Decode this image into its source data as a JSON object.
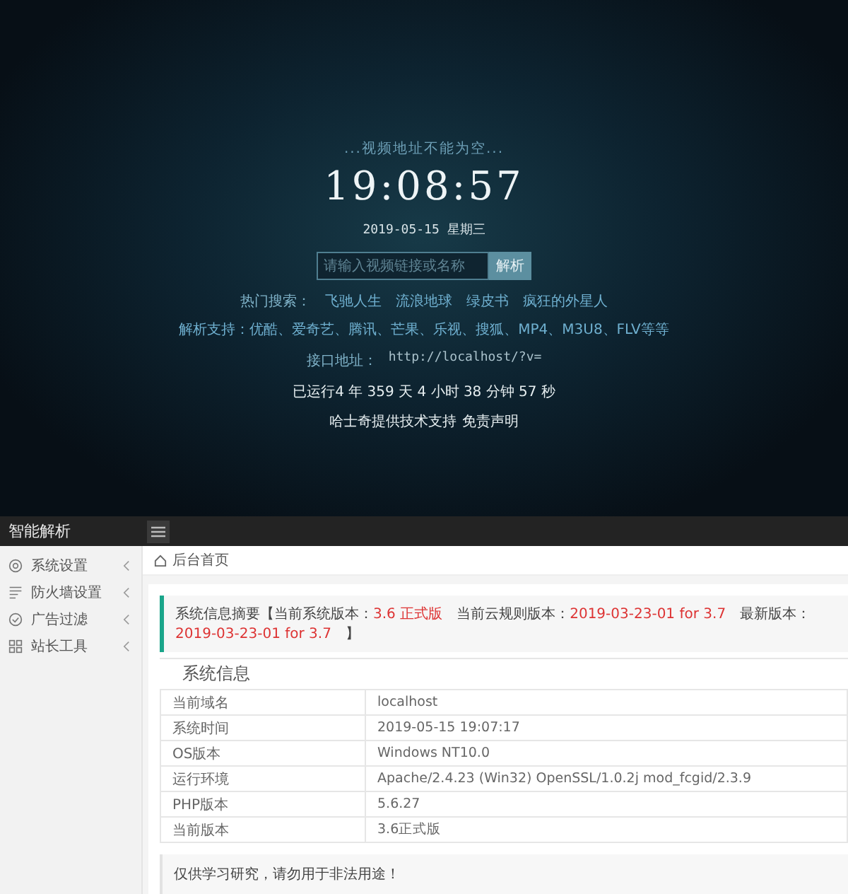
{
  "player": {
    "notice": "...视频地址不能为空...",
    "clock": "19:08:57",
    "date": "2019-05-15 星期三",
    "search": {
      "placeholder": "请输入视频链接或名称",
      "button": "解析"
    },
    "hot": {
      "label": "热门搜索：",
      "items": [
        "飞驰人生",
        "流浪地球",
        "绿皮书",
        "疯狂的外星人"
      ]
    },
    "support": "解析支持：优酷、爱奇艺、腾讯、芒果、乐视、搜狐、MP4、M3U8、FLV等等",
    "api": {
      "label": "接口地址：",
      "url": "http://localhost/?v="
    },
    "uptime": "已运行4 年 359 天 4 小时 38 分钟 57 秒",
    "footer": {
      "credit": "哈士奇提供技术支持",
      "link": "免责声明"
    }
  },
  "admin": {
    "title": "智能解析",
    "sidebar": {
      "items": [
        {
          "label": "系统设置"
        },
        {
          "label": "防火墙设置"
        },
        {
          "label": "广告过滤"
        },
        {
          "label": "站长工具"
        }
      ]
    },
    "breadcrumb": "后台首页",
    "summary": [
      {
        "text": "系统信息摘要【当前系统版本：",
        "highlight": false
      },
      {
        "text": "3.6 正式版",
        "highlight": true
      },
      {
        "text": "　当前云规则版本：",
        "highlight": false
      },
      {
        "text": "2019-03-23-01 for 3.7",
        "highlight": true
      },
      {
        "text": "　最新版本：",
        "highlight": false
      },
      {
        "text": "2019-03-23-01 for 3.7",
        "highlight": true
      },
      {
        "text": "　】",
        "highlight": false
      }
    ],
    "info": {
      "legend": "系统信息",
      "rows": [
        {
          "key": "当前域名",
          "value": "localhost"
        },
        {
          "key": "系统时间",
          "value": "2019-05-15 19:07:17"
        },
        {
          "key": "OS版本",
          "value": "Windows NT10.0"
        },
        {
          "key": "运行环境",
          "value": "Apache/2.4.23 (Win32) OpenSSL/1.0.2j mod_fcgid/2.3.9"
        },
        {
          "key": "PHP版本",
          "value": "5.6.27"
        },
        {
          "key": "当前版本",
          "value": "3.6正式版"
        }
      ]
    },
    "disclaimer": "仅供学习研究，请勿用于非法用途！"
  }
}
